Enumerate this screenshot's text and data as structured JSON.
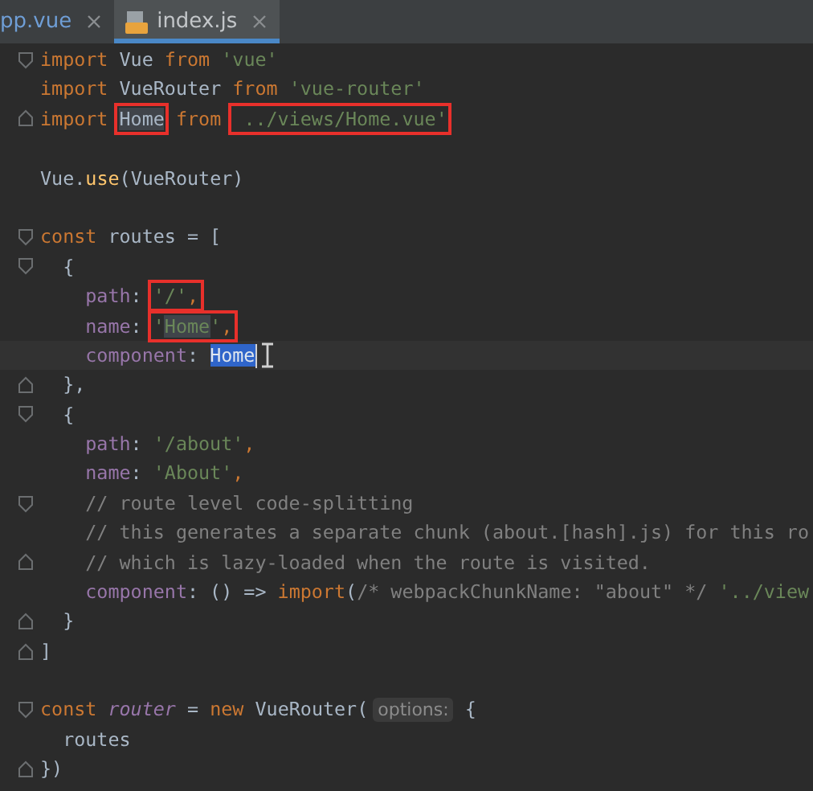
{
  "tabs": [
    {
      "label": "pp.vue",
      "selected": false,
      "kind": "vue"
    },
    {
      "label": "index.js",
      "selected": true,
      "kind": "script"
    }
  ],
  "lines": [
    {
      "kind": "code",
      "expanded": true,
      "tokens": [
        {
          "t": "import",
          "kind": "keyword"
        },
        {
          "t": " Vue ",
          "kind": "plain"
        },
        {
          "t": "from",
          "kind": "keyword"
        },
        {
          "t": " 'vue'",
          "kind": "string"
        }
      ]
    },
    {
      "kind": "code",
      "tokens": [
        {
          "t": "import",
          "kind": "keyword"
        },
        {
          "t": " VueRouter ",
          "kind": "plain"
        },
        {
          "t": "from",
          "kind": "keyword"
        },
        {
          "t": " 'vue-router'",
          "kind": "string"
        }
      ]
    },
    {
      "kind": "code",
      "expanded": false,
      "tokens": [
        {
          "t": "import ",
          "kind": "keyword"
        },
        {
          "kind": "marked",
          "tokens": [
            {
              "t": "Home",
              "kind": "plain",
              "highlighted": true
            }
          ]
        },
        {
          "t": " from ",
          "kind": "keyword"
        },
        {
          "kind": "marked",
          "tokens": [
            {
              "t": " ../views/Home.vue'",
              "kind": "string"
            }
          ]
        }
      ]
    },
    {
      "kind": "blank"
    },
    {
      "kind": "code",
      "tokens": [
        {
          "t": "Vue.",
          "kind": "plain"
        },
        {
          "t": "use",
          "kind": "method"
        },
        {
          "t": "(VueRouter)",
          "kind": "plain"
        }
      ]
    },
    {
      "kind": "blank"
    },
    {
      "kind": "code",
      "expanded": true,
      "tokens": [
        {
          "t": "const",
          "kind": "keyword"
        },
        {
          "t": " routes = [",
          "kind": "plain"
        }
      ]
    },
    {
      "kind": "code",
      "expanded": true,
      "tokens": [
        {
          "t": "  {",
          "kind": "plain"
        }
      ]
    },
    {
      "kind": "code",
      "tokens": [
        {
          "t": "    path",
          "kind": "property"
        },
        {
          "t": ": ",
          "kind": "plain"
        },
        {
          "kind": "marked",
          "tokens": [
            {
              "t": "'/'",
              "kind": "string"
            },
            {
              "t": ",",
              "kind": "keyword"
            }
          ]
        }
      ]
    },
    {
      "kind": "code",
      "tokens": [
        {
          "t": "    name",
          "kind": "property"
        },
        {
          "t": ": ",
          "kind": "plain"
        },
        {
          "kind": "marked",
          "tokens": [
            {
              "t": "'",
              "kind": "string"
            },
            {
              "t": "Home",
              "kind": "string",
              "highlighted": true
            },
            {
              "t": "'",
              "kind": "string"
            },
            {
              "t": ",",
              "kind": "keyword"
            }
          ]
        }
      ]
    },
    {
      "kind": "code",
      "current": true,
      "cursor": true,
      "tokens": [
        {
          "t": "    component",
          "kind": "property"
        },
        {
          "t": ": ",
          "kind": "plain"
        },
        {
          "t": "Home",
          "kind": "plain",
          "selected": true
        }
      ]
    },
    {
      "kind": "code",
      "expanded": false,
      "tokens": [
        {
          "t": "  },",
          "kind": "plain"
        }
      ]
    },
    {
      "kind": "code",
      "expanded": true,
      "tokens": [
        {
          "t": "  {",
          "kind": "plain"
        }
      ]
    },
    {
      "kind": "code",
      "tokens": [
        {
          "t": "    path",
          "kind": "property"
        },
        {
          "t": ": ",
          "kind": "plain"
        },
        {
          "t": "'/about'",
          "kind": "string"
        },
        {
          "t": ",",
          "kind": "keyword"
        }
      ]
    },
    {
      "kind": "code",
      "tokens": [
        {
          "t": "    name",
          "kind": "property"
        },
        {
          "t": ": ",
          "kind": "plain"
        },
        {
          "t": "'About'",
          "kind": "string"
        },
        {
          "t": ",",
          "kind": "keyword"
        }
      ]
    },
    {
      "kind": "code",
      "expanded": true,
      "tokens": [
        {
          "t": "    // route level code-splitting",
          "kind": "comment"
        }
      ]
    },
    {
      "kind": "code",
      "tokens": [
        {
          "t": "    // this generates a separate chunk (about.[hash].js) for this ro",
          "kind": "comment"
        }
      ]
    },
    {
      "kind": "code",
      "expanded": false,
      "tokens": [
        {
          "t": "    // which is lazy-loaded when the route is visited.",
          "kind": "comment"
        }
      ]
    },
    {
      "kind": "code",
      "tokens": [
        {
          "t": "    component",
          "kind": "property"
        },
        {
          "t": ": () => ",
          "kind": "plain"
        },
        {
          "t": "import",
          "kind": "keyword"
        },
        {
          "t": "(",
          "kind": "plain"
        },
        {
          "t": "/* webpackChunkName: \"about\" */",
          "kind": "comment"
        },
        {
          "t": " '../view",
          "kind": "string"
        }
      ]
    },
    {
      "kind": "code",
      "expanded": false,
      "tokens": [
        {
          "t": "  }",
          "kind": "plain"
        }
      ]
    },
    {
      "kind": "code",
      "expanded": false,
      "tokens": [
        {
          "t": "]",
          "kind": "plain"
        }
      ]
    },
    {
      "kind": "blank"
    },
    {
      "kind": "code",
      "expanded": true,
      "tokens": [
        {
          "t": "const ",
          "kind": "keyword"
        },
        {
          "t": "router",
          "kind": "localvar"
        },
        {
          "t": " = ",
          "kind": "plain"
        },
        {
          "t": "new",
          "kind": "keyword"
        },
        {
          "t": " VueRouter(",
          "kind": "plain"
        },
        {
          "t": "options:",
          "kind": "hint"
        },
        {
          "t": " {",
          "kind": "plain"
        }
      ]
    },
    {
      "kind": "code",
      "tokens": [
        {
          "t": "  routes",
          "kind": "plain"
        }
      ]
    },
    {
      "kind": "code",
      "expanded": false,
      "tokens": [
        {
          "t": "})",
          "kind": "plain"
        }
      ]
    }
  ]
}
